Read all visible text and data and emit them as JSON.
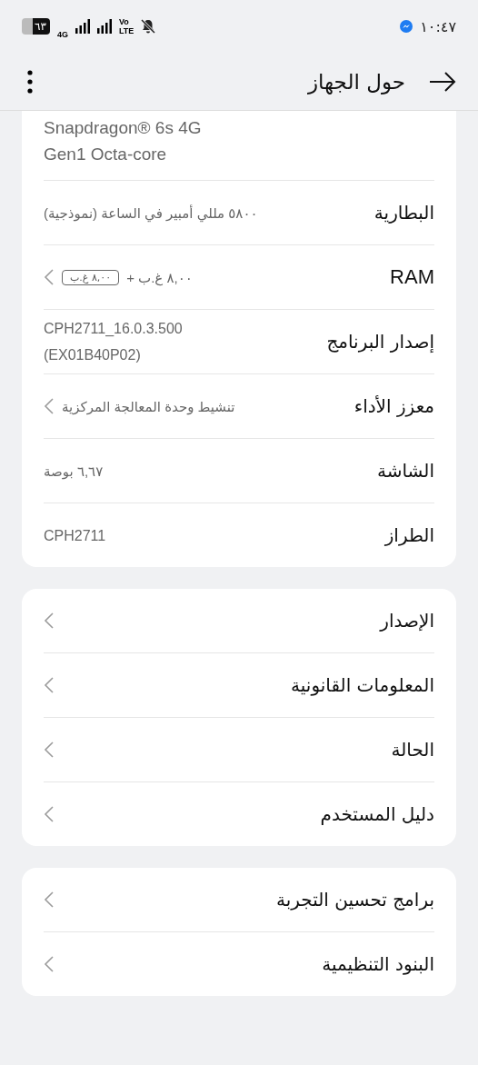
{
  "status_bar": {
    "battery": "٦٣",
    "network": "4G",
    "volte_top": "Vo",
    "volte_bottom": "LTE",
    "time": "١٠:٤٧"
  },
  "header": {
    "title": "حول الجهاز"
  },
  "cards": [
    {
      "rows": [
        {
          "kind": "value_only",
          "value": "Snapdragon® 6s 4G\nGen1 Octa-core"
        },
        {
          "kind": "info",
          "label": "البطارية",
          "value": "٥٨٠٠ مللي أمبير في الساعة (نموذجية)",
          "chevron": false
        },
        {
          "kind": "info",
          "label": "RAM",
          "value": "٨,٠٠ غ.ب +",
          "badge": "٨,٠٠ غ.ب",
          "chevron": true
        },
        {
          "kind": "info",
          "label": "إصدار البرنامج",
          "value": "CPH2711_16.0.3.500\n(EX01B40P02)",
          "chevron": false
        },
        {
          "kind": "info",
          "label": "معزز الأداء",
          "value": "تنشيط وحدة المعالجة المركزية",
          "chevron": true
        },
        {
          "kind": "info",
          "label": "الشاشة",
          "value": "٦,٦٧ بوصة",
          "chevron": false
        },
        {
          "kind": "info",
          "label": "الطراز",
          "value": "CPH2711",
          "chevron": false
        }
      ]
    },
    {
      "rows": [
        {
          "kind": "link",
          "label": "الإصدار",
          "chevron": true
        },
        {
          "kind": "link",
          "label": "المعلومات القانونية",
          "chevron": true
        },
        {
          "kind": "link",
          "label": "الحالة",
          "chevron": true
        },
        {
          "kind": "link",
          "label": "دليل المستخدم",
          "chevron": true
        }
      ]
    },
    {
      "rows": [
        {
          "kind": "link",
          "label": "برامج تحسين التجربة",
          "chevron": true
        },
        {
          "kind": "link",
          "label": "البنود التنظيمية",
          "chevron": true
        }
      ]
    }
  ]
}
